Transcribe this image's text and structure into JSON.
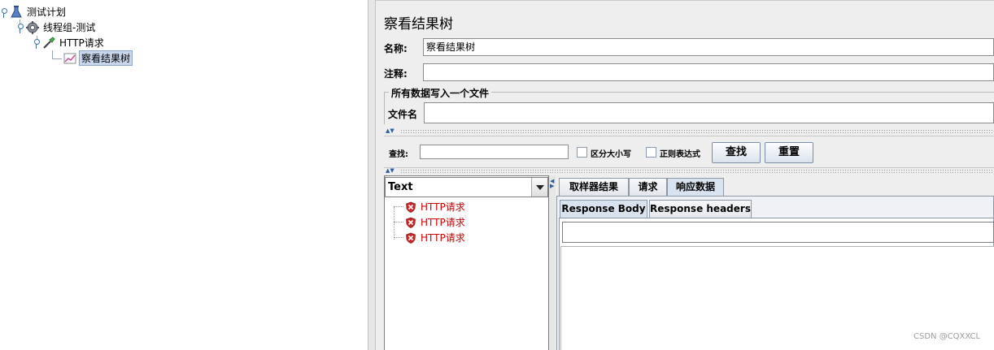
{
  "tree": {
    "test_plan": "测试计划",
    "thread_group": "线程组-测试",
    "http_request": "HTTP请求",
    "result_tree": "察看结果树"
  },
  "panel": {
    "title": "察看结果树",
    "name_label": "名称:",
    "name_value": "察看结果树",
    "comment_label": "注释:",
    "comment_value": "",
    "group_title": "所有数据写入一个文件",
    "filename_label": "文件名",
    "filename_value": ""
  },
  "search": {
    "label": "查找:",
    "value": "",
    "case_label": "区分大小写",
    "regex_label": "正则表达式",
    "find_button": "查找",
    "reset_button": "重置"
  },
  "renderer": {
    "selected": "Text"
  },
  "results": [
    "HTTP请求",
    "HTTP请求",
    "HTTP请求"
  ],
  "tabs": [
    "取样器结果",
    "请求",
    "响应数据"
  ],
  "subtabs": [
    "Response Body",
    "Response headers"
  ],
  "colors": {
    "error_text": "#cc0000",
    "selected_bg": "#c8d8ec"
  },
  "watermark": "CSDN @CQXXCL"
}
